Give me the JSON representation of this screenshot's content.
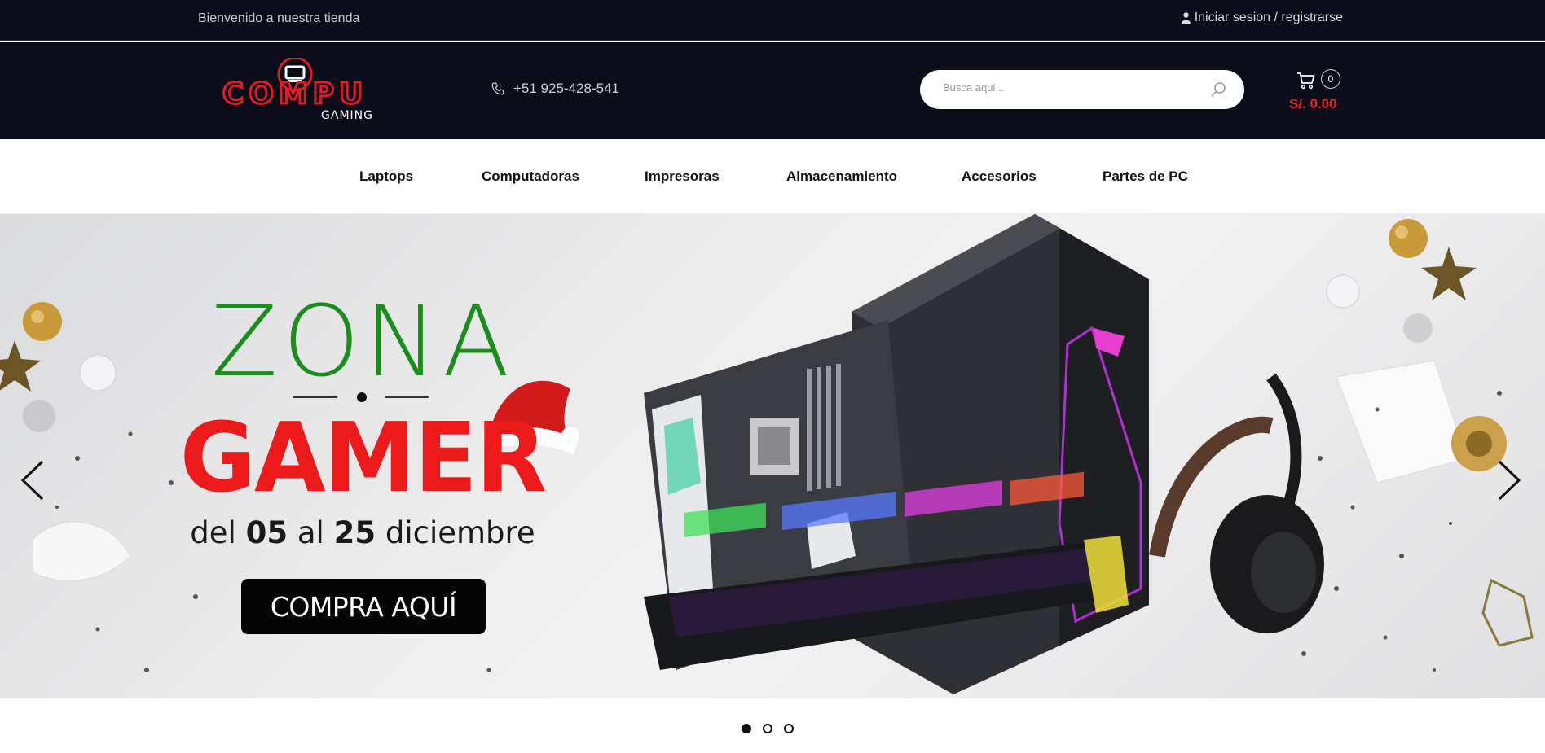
{
  "topbar": {
    "welcome": "Bienvenido a nuestra tienda",
    "login_label": "Iniciar sesion / registrarse"
  },
  "header": {
    "logo_text_main": "COMPU",
    "logo_text_sub": "GAMING",
    "phone": "+51 925-428-541",
    "search_placeholder": "Busca aqui...",
    "cart_count": "0",
    "cart_total": "S/. 0.00"
  },
  "nav": {
    "items": [
      {
        "label": "Laptops"
      },
      {
        "label": "Computadoras"
      },
      {
        "label": "Impresoras"
      },
      {
        "label": "Almacenamiento"
      },
      {
        "label": "Accesorios"
      },
      {
        "label": "Partes de PC"
      }
    ]
  },
  "slider": {
    "headline_top": "ZONA",
    "headline_main": "GAMER",
    "dates_pre": "del",
    "dates_from": "05",
    "dates_mid": "al",
    "dates_to": "25",
    "dates_post": "diciembre",
    "cta_label": "COMPRA AQUÍ",
    "slide_count": 3,
    "active_slide": 1
  },
  "colors": {
    "header_bg": "#0a0c1a",
    "accent_red": "#e8222b",
    "headline_green": "#1a8d1a",
    "headline_red": "#ec1a1a"
  }
}
